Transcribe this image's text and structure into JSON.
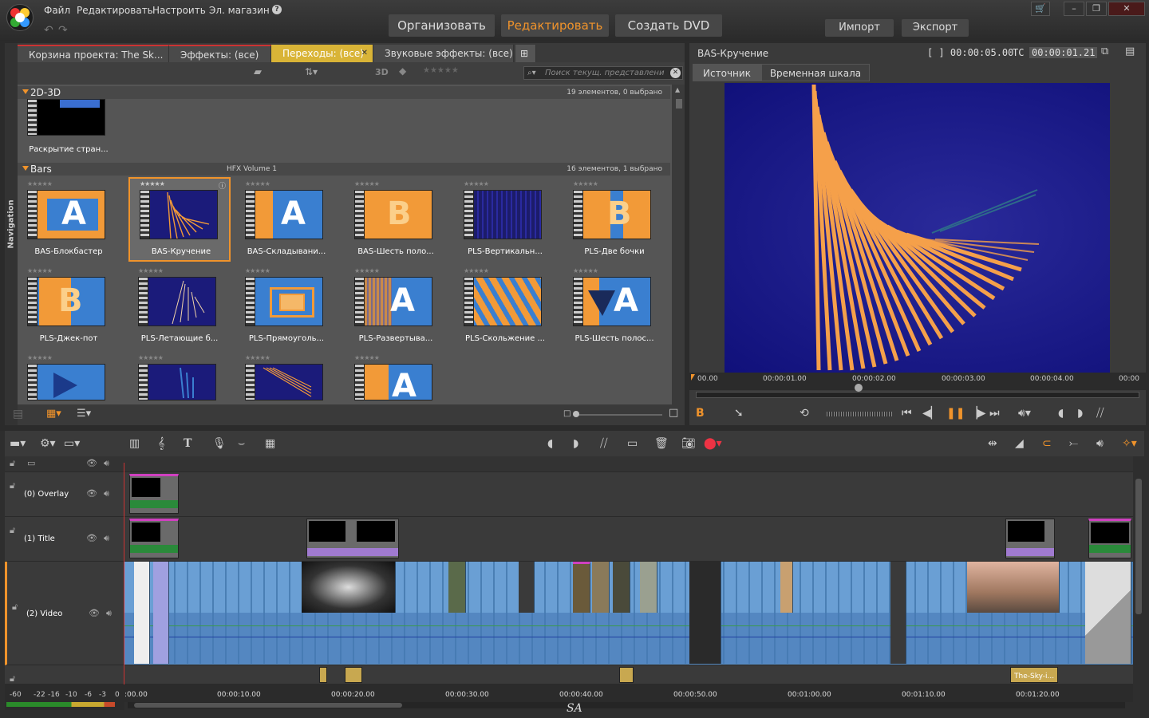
{
  "menu": {
    "file": "Файл",
    "edit": "Редактировать",
    "setup": "Настроить",
    "store": "Эл. магазин",
    "help": "?"
  },
  "modes": {
    "organize": "Организовать",
    "edit": "Редактировать",
    "dvd": "Создать DVD"
  },
  "io": {
    "import": "Импорт",
    "export": "Экспорт"
  },
  "window": {
    "cart": "🛒",
    "minimize": "–",
    "restore": "❐",
    "close": "✕"
  },
  "library": {
    "nav_label": "Navigation",
    "tabs": [
      {
        "label": "Корзина проекта: The Sk..."
      },
      {
        "label": "Эффекты: (все)"
      },
      {
        "label": "Переходы: (все)"
      },
      {
        "label": "Звуковые эффекты: (все)"
      }
    ],
    "toolbar": {
      "three_d": "3D",
      "search_placeholder": "Поиск текущ. представлени"
    },
    "sections": [
      {
        "name": "2D-3D",
        "sub": "",
        "count": "19 элементов, 0 выбрано",
        "items": [
          {
            "label": "Раскрытие стран..."
          }
        ]
      },
      {
        "name": "Bars",
        "sub": "HFX Volume 1",
        "count": "16 элементов, 1 выбрано",
        "items": [
          {
            "label": "BAS-Блокбастер"
          },
          {
            "label": "BAS-Кручение"
          },
          {
            "label": "BAS-Складывани..."
          },
          {
            "label": "BAS-Шесть поло..."
          },
          {
            "label": "PLS-Вертикальн..."
          },
          {
            "label": "PLS-Две бочки"
          },
          {
            "label": "PLS-Джек-пот"
          },
          {
            "label": "PLS-Летающие б..."
          },
          {
            "label": "PLS-Прямоуголь..."
          },
          {
            "label": "PLS-Развертыва..."
          },
          {
            "label": "PLS-Скольжение ..."
          },
          {
            "label": "PLS-Шесть полос..."
          }
        ]
      }
    ],
    "stars": "★★★★★"
  },
  "player": {
    "title": "BAS-Кручение",
    "duration": "[ ] 00:00:05.00",
    "tc_label": "TC",
    "timecode": "00:00:01.21",
    "tabs": {
      "source": "Источник",
      "timeline": "Временная шкала"
    },
    "ruler": [
      "00.00",
      "00:00:01.00",
      "00:00:02.00",
      "00:00:03.00",
      "00:00:04.00",
      "00:00"
    ],
    "mark": "B"
  },
  "timeline": {
    "tracks": [
      {
        "name": "(0) Overlay"
      },
      {
        "name": "(1) Title"
      },
      {
        "name": "(2) Video"
      }
    ],
    "ruler": [
      ":00.00",
      "00:00:10.00",
      "00:00:20.00",
      "00:00:30.00",
      "00:00:40.00",
      "00:00:50.00",
      "00:01:00.00",
      "00:01:10.00",
      "00:01:20.00"
    ],
    "meter": [
      "-60",
      "-22",
      "-16",
      "-10",
      "-6",
      "-3",
      "0"
    ],
    "clip_label": "The-Sky-i..."
  },
  "watermark": "SA",
  "colors": {
    "accent": "#f0932b",
    "active_tab": "#d9b437",
    "preview_bg": "#16168a",
    "video_clip": "#5a8fc4"
  }
}
